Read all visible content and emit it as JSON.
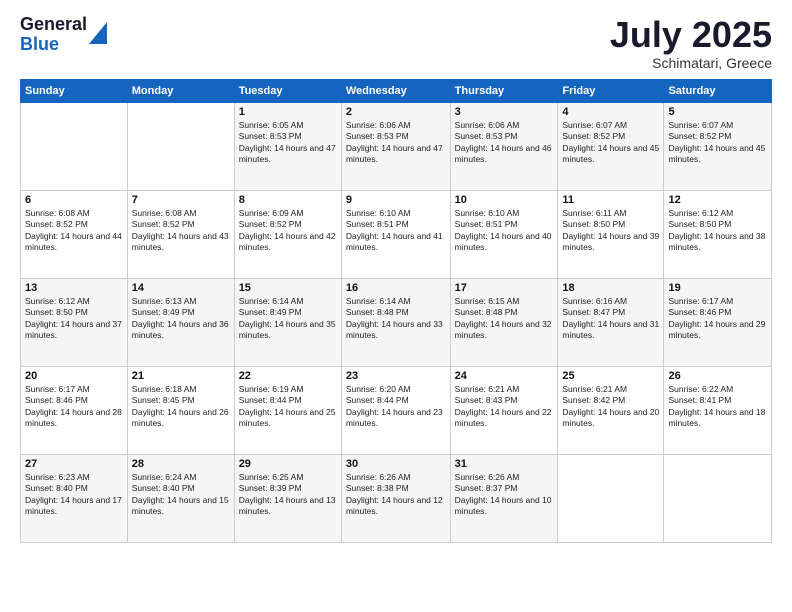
{
  "logo": {
    "general": "General",
    "blue": "Blue"
  },
  "title": "July 2025",
  "location": "Schimatari, Greece",
  "days_header": [
    "Sunday",
    "Monday",
    "Tuesday",
    "Wednesday",
    "Thursday",
    "Friday",
    "Saturday"
  ],
  "weeks": [
    [
      {
        "num": "",
        "info": ""
      },
      {
        "num": "",
        "info": ""
      },
      {
        "num": "1",
        "info": "Sunrise: 6:05 AM\nSunset: 8:53 PM\nDaylight: 14 hours and 47 minutes."
      },
      {
        "num": "2",
        "info": "Sunrise: 6:06 AM\nSunset: 8:53 PM\nDaylight: 14 hours and 47 minutes."
      },
      {
        "num": "3",
        "info": "Sunrise: 6:06 AM\nSunset: 8:53 PM\nDaylight: 14 hours and 46 minutes."
      },
      {
        "num": "4",
        "info": "Sunrise: 6:07 AM\nSunset: 8:52 PM\nDaylight: 14 hours and 45 minutes."
      },
      {
        "num": "5",
        "info": "Sunrise: 6:07 AM\nSunset: 8:52 PM\nDaylight: 14 hours and 45 minutes."
      }
    ],
    [
      {
        "num": "6",
        "info": "Sunrise: 6:08 AM\nSunset: 8:52 PM\nDaylight: 14 hours and 44 minutes."
      },
      {
        "num": "7",
        "info": "Sunrise: 6:08 AM\nSunset: 8:52 PM\nDaylight: 14 hours and 43 minutes."
      },
      {
        "num": "8",
        "info": "Sunrise: 6:09 AM\nSunset: 8:52 PM\nDaylight: 14 hours and 42 minutes."
      },
      {
        "num": "9",
        "info": "Sunrise: 6:10 AM\nSunset: 8:51 PM\nDaylight: 14 hours and 41 minutes."
      },
      {
        "num": "10",
        "info": "Sunrise: 6:10 AM\nSunset: 8:51 PM\nDaylight: 14 hours and 40 minutes."
      },
      {
        "num": "11",
        "info": "Sunrise: 6:11 AM\nSunset: 8:50 PM\nDaylight: 14 hours and 39 minutes."
      },
      {
        "num": "12",
        "info": "Sunrise: 6:12 AM\nSunset: 8:50 PM\nDaylight: 14 hours and 38 minutes."
      }
    ],
    [
      {
        "num": "13",
        "info": "Sunrise: 6:12 AM\nSunset: 8:50 PM\nDaylight: 14 hours and 37 minutes."
      },
      {
        "num": "14",
        "info": "Sunrise: 6:13 AM\nSunset: 8:49 PM\nDaylight: 14 hours and 36 minutes."
      },
      {
        "num": "15",
        "info": "Sunrise: 6:14 AM\nSunset: 8:49 PM\nDaylight: 14 hours and 35 minutes."
      },
      {
        "num": "16",
        "info": "Sunrise: 6:14 AM\nSunset: 8:48 PM\nDaylight: 14 hours and 33 minutes."
      },
      {
        "num": "17",
        "info": "Sunrise: 6:15 AM\nSunset: 8:48 PM\nDaylight: 14 hours and 32 minutes."
      },
      {
        "num": "18",
        "info": "Sunrise: 6:16 AM\nSunset: 8:47 PM\nDaylight: 14 hours and 31 minutes."
      },
      {
        "num": "19",
        "info": "Sunrise: 6:17 AM\nSunset: 8:46 PM\nDaylight: 14 hours and 29 minutes."
      }
    ],
    [
      {
        "num": "20",
        "info": "Sunrise: 6:17 AM\nSunset: 8:46 PM\nDaylight: 14 hours and 28 minutes."
      },
      {
        "num": "21",
        "info": "Sunrise: 6:18 AM\nSunset: 8:45 PM\nDaylight: 14 hours and 26 minutes."
      },
      {
        "num": "22",
        "info": "Sunrise: 6:19 AM\nSunset: 8:44 PM\nDaylight: 14 hours and 25 minutes."
      },
      {
        "num": "23",
        "info": "Sunrise: 6:20 AM\nSunset: 8:44 PM\nDaylight: 14 hours and 23 minutes."
      },
      {
        "num": "24",
        "info": "Sunrise: 6:21 AM\nSunset: 8:43 PM\nDaylight: 14 hours and 22 minutes."
      },
      {
        "num": "25",
        "info": "Sunrise: 6:21 AM\nSunset: 8:42 PM\nDaylight: 14 hours and 20 minutes."
      },
      {
        "num": "26",
        "info": "Sunrise: 6:22 AM\nSunset: 8:41 PM\nDaylight: 14 hours and 18 minutes."
      }
    ],
    [
      {
        "num": "27",
        "info": "Sunrise: 6:23 AM\nSunset: 8:40 PM\nDaylight: 14 hours and 17 minutes."
      },
      {
        "num": "28",
        "info": "Sunrise: 6:24 AM\nSunset: 8:40 PM\nDaylight: 14 hours and 15 minutes."
      },
      {
        "num": "29",
        "info": "Sunrise: 6:25 AM\nSunset: 8:39 PM\nDaylight: 14 hours and 13 minutes."
      },
      {
        "num": "30",
        "info": "Sunrise: 6:26 AM\nSunset: 8:38 PM\nDaylight: 14 hours and 12 minutes."
      },
      {
        "num": "31",
        "info": "Sunrise: 6:26 AM\nSunset: 8:37 PM\nDaylight: 14 hours and 10 minutes."
      },
      {
        "num": "",
        "info": ""
      },
      {
        "num": "",
        "info": ""
      }
    ]
  ]
}
